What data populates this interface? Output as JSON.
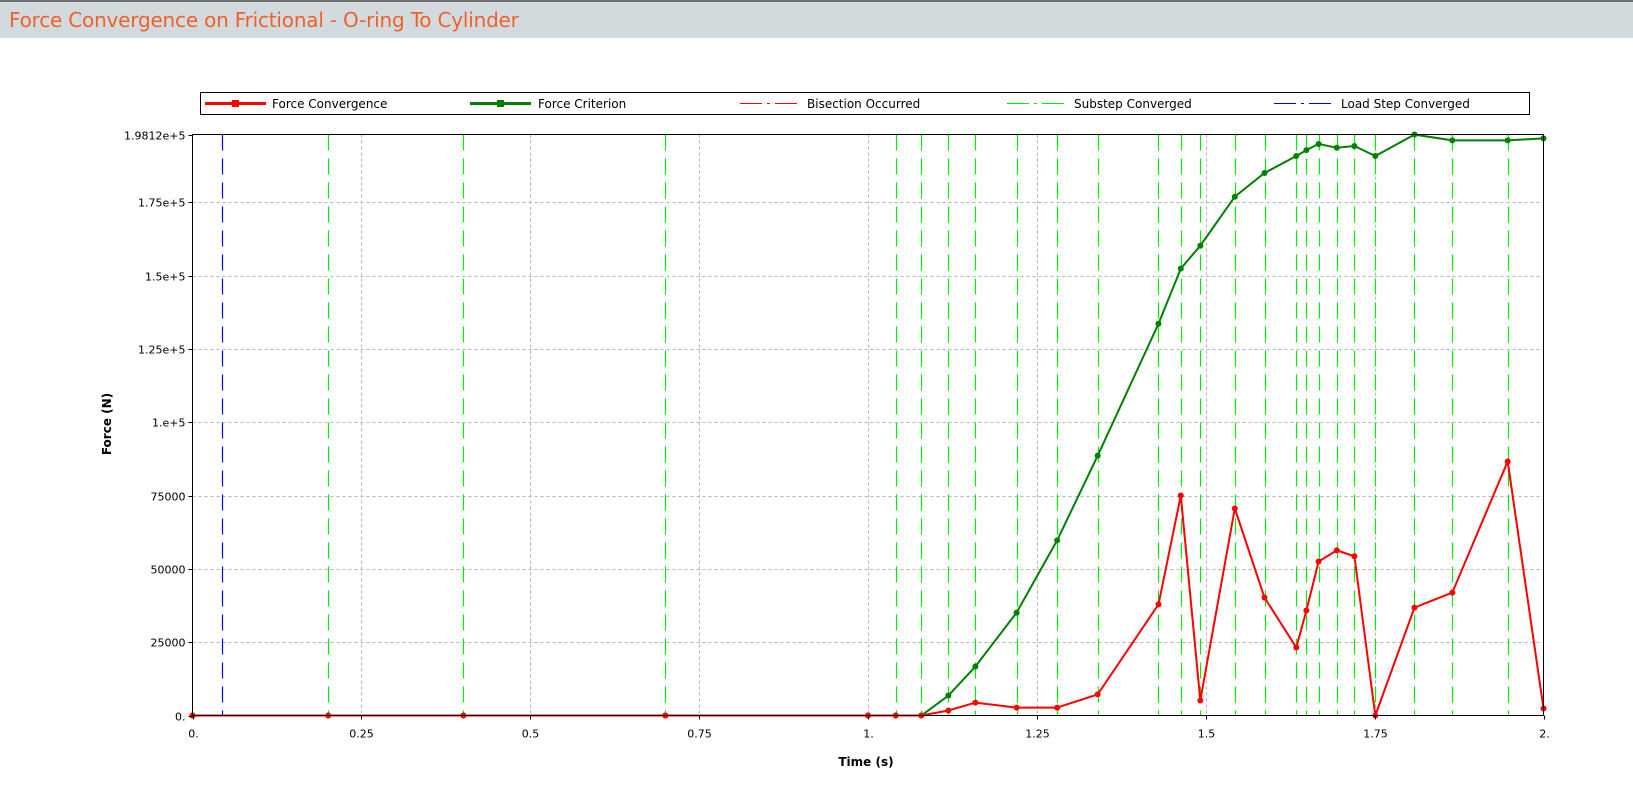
{
  "window": {
    "title": "Force Convergence on Frictional - O-ring To Cylinder"
  },
  "colors": {
    "force_convergence": "#ff0000",
    "force_criterion": "#008000",
    "bisection": "#ff0000",
    "substep": "#00ee00",
    "load_step": "#0000ff",
    "title": "#f0602a"
  },
  "chart_data": {
    "type": "line",
    "title": "Force Convergence on Frictional - O-ring To Cylinder",
    "xlabel": "Time (s)",
    "ylabel": "Force (N)",
    "xlim": [
      0,
      2
    ],
    "ylim": [
      0,
      198120
    ],
    "x_ticks": [
      0,
      0.25,
      0.5,
      0.75,
      1,
      1.25,
      1.5,
      1.75,
      2
    ],
    "x_tick_labels": [
      "0.",
      "0.25",
      "0.5",
      "0.75",
      "1.",
      "1.25",
      "1.5",
      "1.75",
      "2."
    ],
    "y_ticks": [
      0,
      25000,
      50000,
      75000,
      100000,
      125000,
      150000,
      175000,
      198120
    ],
    "y_tick_labels": [
      "0.",
      "25000",
      "50000",
      "75000",
      "1.e+5",
      "1.25e+5",
      "1.5e+5",
      "1.75e+5",
      "1.9812e+5"
    ],
    "grid": true,
    "legend_placement": "top",
    "legend": [
      "Force Convergence",
      "Force Criterion",
      "Bisection Occurred",
      "Substep Converged",
      "Load Step Converged"
    ],
    "x": [
      0,
      0.201,
      0.401,
      0.7,
      1.0,
      1.041,
      1.079,
      1.119,
      1.159,
      1.22,
      1.28,
      1.34,
      1.43,
      1.463,
      1.492,
      1.543,
      1.587,
      1.634,
      1.649,
      1.667,
      1.694,
      1.72,
      1.751,
      1.809,
      1.865,
      1.947,
      2.0
    ],
    "series": [
      {
        "name": "Force Convergence",
        "values": [
          0,
          0,
          0,
          0,
          0,
          0,
          0,
          1700,
          4400,
          2700,
          2700,
          7200,
          37900,
          75000,
          5100,
          70600,
          40200,
          23200,
          35800,
          52500,
          56300,
          54300,
          0,
          36800,
          41900,
          86600,
          2400
        ]
      },
      {
        "name": "Force Criterion",
        "values": [
          0,
          0,
          0,
          0,
          0,
          0,
          0,
          6800,
          16700,
          35100,
          59700,
          88600,
          133600,
          152400,
          160200,
          176900,
          185000,
          190800,
          192800,
          194900,
          193600,
          194200,
          190800,
          198100,
          196100,
          196100,
          196800
        ]
      }
    ],
    "substep_converged_times": [
      0.201,
      0.401,
      0.7,
      1.041,
      1.079,
      1.119,
      1.159,
      1.22,
      1.28,
      1.34,
      1.43,
      1.463,
      1.492,
      1.543,
      1.587,
      1.634,
      1.649,
      1.667,
      1.694,
      1.72,
      1.751,
      1.809,
      1.865,
      1.947
    ],
    "load_step_converged_times": [
      0.043
    ],
    "bisection_times": []
  }
}
